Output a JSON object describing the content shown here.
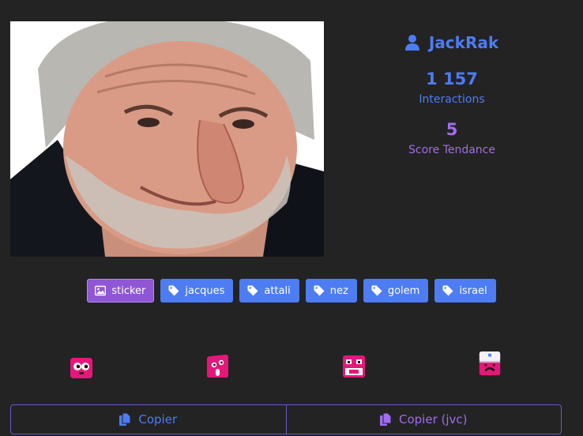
{
  "post": {
    "image_alt": "sticker image: smiling man with grey hair",
    "author": "JackRak",
    "interactions_value": "1 157",
    "interactions_label": "Interactions",
    "trend_value": "5",
    "trend_label": "Score Tendance"
  },
  "tags": [
    {
      "label": "sticker",
      "icon": "image-icon"
    },
    {
      "label": "jacques",
      "icon": "tag-icon"
    },
    {
      "label": "attali",
      "icon": "tag-icon"
    },
    {
      "label": "nez",
      "icon": "tag-icon"
    },
    {
      "label": "golem",
      "icon": "tag-icon"
    },
    {
      "label": "israel",
      "icon": "tag-icon"
    }
  ],
  "reactions": [
    "surprised-face-icon",
    "drooling-face-icon",
    "grimacing-face-icon",
    "frowning-face-icon"
  ],
  "copy": {
    "copy_label": "Copier",
    "copy_jvc_label": "Copier (jvc)"
  },
  "colors": {
    "background": "#232323",
    "accent_blue": "#4d7cf3",
    "accent_purple": "#a06cf0",
    "reaction_pink": "#e6177a"
  }
}
